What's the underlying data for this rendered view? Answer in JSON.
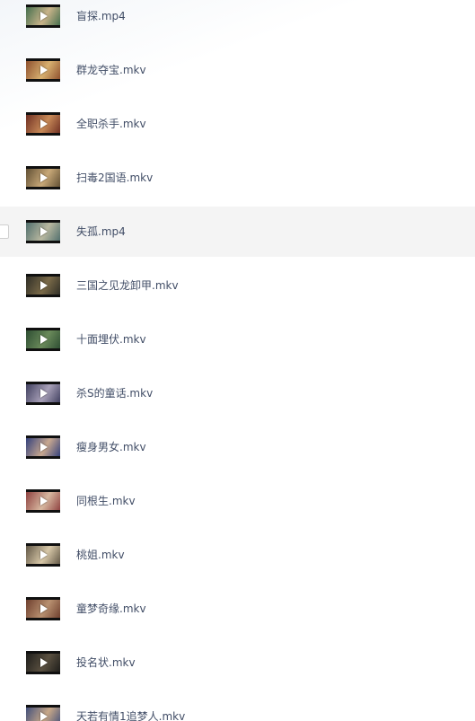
{
  "files": [
    {
      "name": "盲探.mp4",
      "thumb_colors": [
        "#3c6a4a",
        "#c9b48a"
      ]
    },
    {
      "name": "群龙夺宝.mkv",
      "thumb_colors": [
        "#8a4a2a",
        "#d8b070"
      ]
    },
    {
      "name": "全职杀手.mkv",
      "thumb_colors": [
        "#6a2a20",
        "#c88a58"
      ]
    },
    {
      "name": "扫毒2国语.mkv",
      "thumb_colors": [
        "#5a4a30",
        "#c8a878"
      ]
    },
    {
      "name": "失孤.mp4",
      "thumb_colors": [
        "#4a6a6a",
        "#b8b8a0"
      ],
      "hovered": true
    },
    {
      "name": "三国之见龙卸甲.mkv",
      "thumb_colors": [
        "#2a2a24",
        "#7a6a48"
      ]
    },
    {
      "name": "十面埋伏.mkv",
      "thumb_colors": [
        "#2a4a30",
        "#6a8a5a"
      ]
    },
    {
      "name": "杀S的童话.mkv",
      "thumb_colors": [
        "#3a3a5a",
        "#a8a0b8"
      ]
    },
    {
      "name": "瘦身男女.mkv",
      "thumb_colors": [
        "#2a3a7a",
        "#c8a890"
      ]
    },
    {
      "name": "同根生.mkv",
      "thumb_colors": [
        "#8a3a3a",
        "#d8b8a0"
      ]
    },
    {
      "name": "桃姐.mkv",
      "thumb_colors": [
        "#5a5040",
        "#d8c8a8"
      ]
    },
    {
      "name": "童梦奇缘.mkv",
      "thumb_colors": [
        "#6a3a2a",
        "#b89070"
      ]
    },
    {
      "name": "投名状.mkv",
      "thumb_colors": [
        "#1a1a18",
        "#5a5040"
      ]
    },
    {
      "name": "天若有情1追梦人.mkv",
      "thumb_colors": [
        "#3a4a7a",
        "#c8a888"
      ]
    }
  ]
}
